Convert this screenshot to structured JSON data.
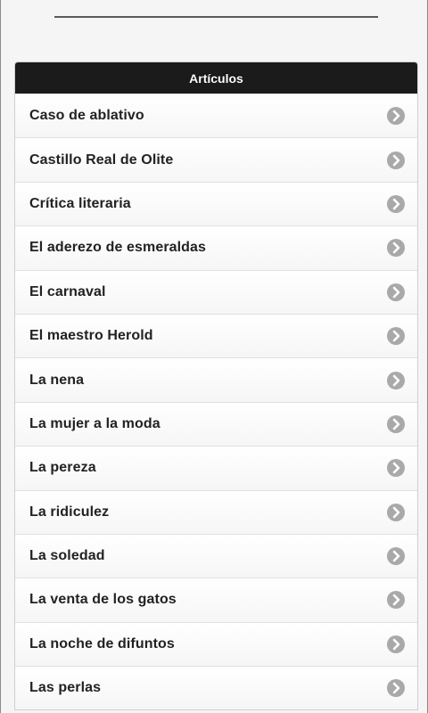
{
  "header": {
    "title": "Artículos"
  },
  "items": [
    {
      "label": "Caso de ablativo"
    },
    {
      "label": "Castillo Real de Olite"
    },
    {
      "label": "Crítica literaria"
    },
    {
      "label": "El aderezo de esmeraldas"
    },
    {
      "label": "El carnaval"
    },
    {
      "label": "El maestro Herold"
    },
    {
      "label": "La nena"
    },
    {
      "label": "La mujer a la moda"
    },
    {
      "label": "La pereza"
    },
    {
      "label": "La ridiculez"
    },
    {
      "label": "La soledad"
    },
    {
      "label": "La venta de los gatos"
    },
    {
      "label": "La noche de difuntos"
    },
    {
      "label": "Las perlas"
    }
  ],
  "icons": {
    "item_arrow": "chevron-right-circle-icon"
  },
  "colors": {
    "header_bg": "#1b1b1b",
    "chevron": "#a9a9a9"
  }
}
